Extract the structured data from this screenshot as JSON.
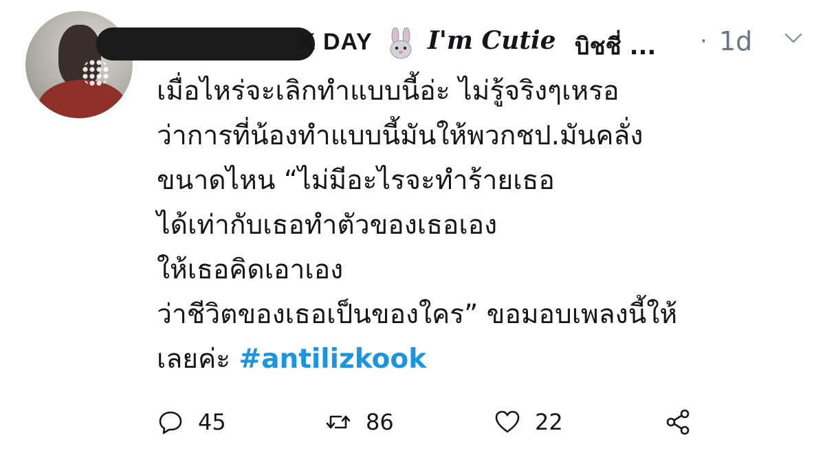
{
  "tweet": {
    "display_name_tail": "K DAY",
    "display_name_italic": "I'm Cutie",
    "display_name_thai": "บิชชี่ ...",
    "separator": "·",
    "time": "1d",
    "lines": [
      "เมื่อไหร่จะเลิกทำแบบนี้อ่ะ ไม่รู้จริงๆเหรอ",
      "ว่าการที่น้องทำแบบนี้มันให้พวกชป.มันคลั่ง",
      "ขนาดไหน  “ไม่มีอะไรจะทำร้ายเธอ",
      "ได้เท่ากับเธอทำตัวของเธอเอง",
      "ให้เธอคิดเอาเอง",
      "ว่าชีวิตของเธอเป็นของใคร” ขอมอบเพลงนี้ให้"
    ],
    "last_line_prefix": "เลยค่ะ ",
    "hashtag": "#antilizkook",
    "actions": {
      "reply_count": "45",
      "retweet_count": "86",
      "like_count": "22"
    },
    "icons": {
      "reply": "reply-icon",
      "retweet": "retweet-icon",
      "like": "heart-icon",
      "share": "share-icon",
      "menu": "chevron-down-icon",
      "emoji": "rabbit-icon"
    },
    "colors": {
      "text": "#14171a",
      "muted": "#657786",
      "link": "#1b95e0"
    }
  }
}
